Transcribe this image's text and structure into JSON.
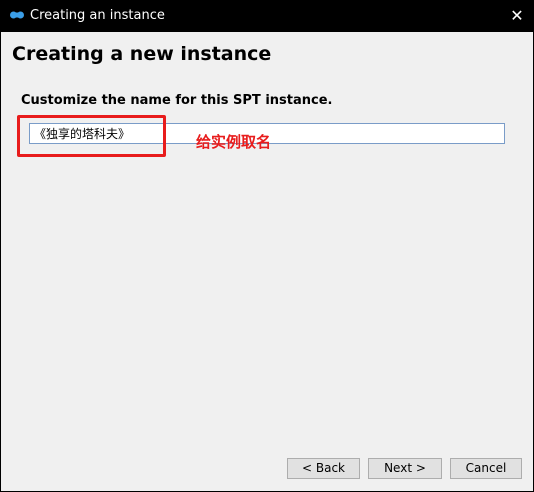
{
  "window": {
    "title": "Creating an instance",
    "app_icon": "infinity-logo-icon",
    "close_glyph": "✕"
  },
  "page": {
    "heading": "Creating a new instance",
    "field_label": "Customize the name for this SPT instance."
  },
  "name_input": {
    "value": "《独享的塔科夫》"
  },
  "annotation": {
    "text": "给实例取名",
    "color": "#e81c1c"
  },
  "buttons": {
    "back": "< Back",
    "next": "Next >",
    "cancel": "Cancel"
  },
  "colors": {
    "titlebar": "#000000",
    "content_bg": "#f0f0f0",
    "accent_icon": "#3b9ee8"
  }
}
